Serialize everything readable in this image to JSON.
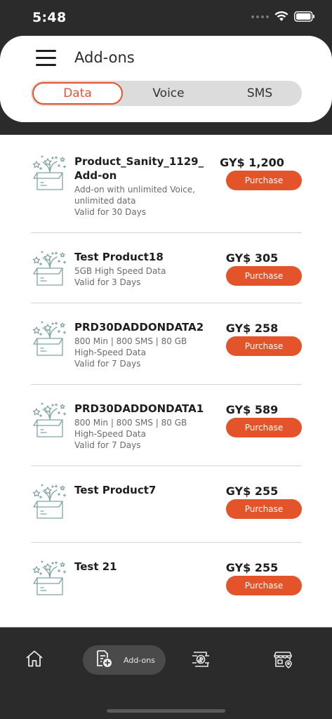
{
  "status": {
    "time": "5:48"
  },
  "header": {
    "title": "Add-ons"
  },
  "tabs": [
    {
      "label": "Data"
    },
    {
      "label": "Voice"
    },
    {
      "label": "SMS"
    }
  ],
  "products": [
    {
      "name": "Product_Sanity_1129_Add-on",
      "desc": "Add-on with unlimited Voice, unlimited data",
      "validity": "Valid for 30 Days",
      "price": "GY$ 1,200",
      "button": "Purchase"
    },
    {
      "name": "Test Product18",
      "desc": "5GB High Speed Data",
      "validity": "Valid for 3 Days",
      "price": "GY$ 305",
      "button": "Purchase"
    },
    {
      "name": "PRD30DADDONDATA2",
      "desc": "800 Min | 800 SMS | 80 GB High-Speed Data",
      "validity": "Valid for 7 Days",
      "price": "GY$ 258",
      "button": "Purchase"
    },
    {
      "name": "PRD30DADDONDATA1",
      "desc": "800 Min | 800 SMS | 80 GB High-Speed Data",
      "validity": "Valid for 7 Days",
      "price": "GY$ 589",
      "button": "Purchase"
    },
    {
      "name": "Test Product7",
      "desc": "",
      "validity": "",
      "price": "GY$ 255",
      "button": "Purchase"
    },
    {
      "name": "Test 21",
      "desc": "",
      "validity": "",
      "price": "GY$ 255",
      "button": "Purchase"
    }
  ],
  "nav": {
    "addons_label": "Add-ons"
  },
  "colors": {
    "accent": "#e4542a",
    "dark": "#2b2b2b",
    "icon_teal": "#7fa3a3"
  },
  "icons": {
    "menu": "hamburger-menu-icon",
    "product": "gift-box-icon",
    "home": "home-icon",
    "addons": "add-on-plan-icon",
    "payment": "payment-icon",
    "store": "store-locator-icon"
  }
}
